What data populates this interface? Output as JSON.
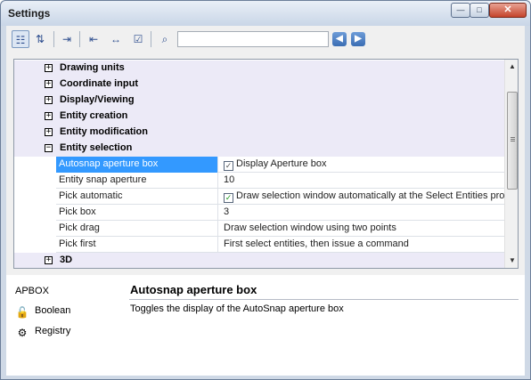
{
  "window": {
    "title": "Settings",
    "minimize_glyph": "—",
    "maximize_glyph": "□",
    "close_glyph": "✕"
  },
  "toolbar": {
    "tools": [
      {
        "name": "categorized-view-icon",
        "glyph": "☷"
      },
      {
        "name": "alphabetical-sort-icon",
        "glyph": "⇅"
      },
      {
        "name": "export-icon",
        "glyph": "⇥"
      },
      {
        "name": "import-icon",
        "glyph": "⇤"
      },
      {
        "name": "dimension-icon",
        "glyph": "↔"
      },
      {
        "name": "checklist-icon",
        "glyph": "☑"
      },
      {
        "name": "find-icon",
        "glyph": "⌕"
      }
    ],
    "search_value": "",
    "prev_glyph": "◀",
    "next_glyph": "▶"
  },
  "tree": {
    "categories": [
      {
        "label": "Drawing units",
        "expander": "+"
      },
      {
        "label": "Coordinate input",
        "expander": "+"
      },
      {
        "label": "Display/Viewing",
        "expander": "+"
      },
      {
        "label": "Entity creation",
        "expander": "+"
      },
      {
        "label": "Entity modification",
        "expander": "+"
      },
      {
        "label": "Entity selection",
        "expander": "−"
      }
    ],
    "properties": [
      {
        "name": "Autosnap aperture box",
        "value": "Display Aperture box",
        "checkbox": "gray"
      },
      {
        "name": "Entity snap aperture",
        "value": "10",
        "checkbox": ""
      },
      {
        "name": "Pick automatic",
        "value": "Draw selection window automatically at the Select Entities pro",
        "checkbox": "green"
      },
      {
        "name": "Pick box",
        "value": "3",
        "checkbox": ""
      },
      {
        "name": "Pick drag",
        "value": "Draw selection window using two points",
        "checkbox": ""
      },
      {
        "name": "Pick first",
        "value": "First select entities, then issue a command",
        "checkbox": ""
      }
    ],
    "last_category": {
      "label": "3D",
      "expander": "+"
    },
    "check_glyph": "✓"
  },
  "info": {
    "variable": "APBOX",
    "type_label": "Boolean",
    "storage_label": "Registry",
    "title": "Autosnap aperture box",
    "description": "Toggles the display of the AutoSnap aperture box"
  },
  "colors": {
    "selection": "#3399ff",
    "category_bg": "#eceaf7",
    "window_frame": "#cfd9e6"
  }
}
